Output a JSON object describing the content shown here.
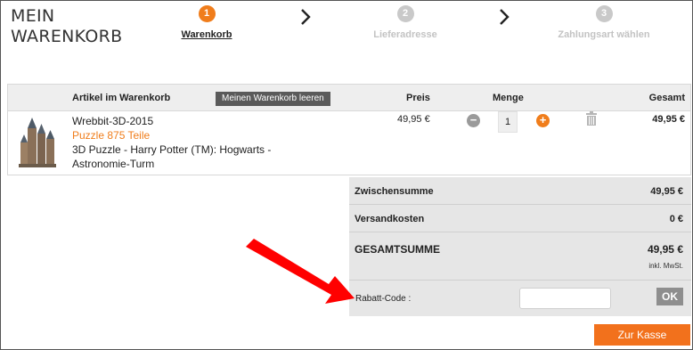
{
  "page": {
    "title_line1": "MEIN",
    "title_line2": "WARENKORB"
  },
  "steps": [
    {
      "number": "1",
      "label": "Warenkorb",
      "state": "active"
    },
    {
      "number": "2",
      "label": "Lieferadresse",
      "state": "inactive"
    },
    {
      "number": "3",
      "label": "Zahlungsart wählen",
      "state": "inactive"
    }
  ],
  "cart": {
    "headers": {
      "item": "Artikel im Warenkorb",
      "price": "Preis",
      "quantity": "Menge",
      "total": "Gesamt"
    },
    "clear_button": "Meinen Warenkorb leeren",
    "items": [
      {
        "sku": "Wrebbit-3D-2015",
        "type": "Puzzle 875 Teile",
        "description": "3D Puzzle - Harry Potter (TM): Hogwarts - Astronomie-Turm",
        "price": "49,95 €",
        "quantity": "1",
        "total": "49,95 €",
        "image_icon": "hogwarts-puzzle-thumbnail"
      }
    ]
  },
  "summary": {
    "subtotal_label": "Zwischensumme",
    "subtotal_value": "49,95 €",
    "shipping_label": "Versandkosten",
    "shipping_value": "0 €",
    "grand_total_label": "GESAMTSUMME",
    "grand_total_value": "49,95 €",
    "tax_note": "inkl. MwSt.",
    "coupon_label": "Rabatt-Code :",
    "coupon_value": "",
    "coupon_button": "OK"
  },
  "checkout_button": "Zur Kasse",
  "colors": {
    "accent": "#f07d1b",
    "arrow": "#ff0000",
    "header_bg": "#eeeeee",
    "summary_bg": "#e6e6e6"
  }
}
